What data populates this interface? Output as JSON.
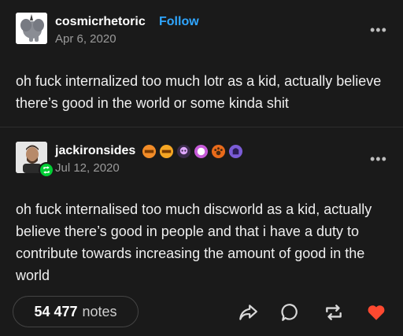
{
  "post1": {
    "username": "cosmicrhetoric",
    "follow_label": "Follow",
    "date": "Apr 6, 2020",
    "text": "oh fuck internalized too much lotr as a kid, actually believe there’s good in the world or some kinda shit",
    "more_label": "•••"
  },
  "post2": {
    "username": "jackironsides",
    "date": "Jul 12, 2020",
    "text": "oh fuck internalised too much discworld as a kid, actually believe there’s good in people and that i have a duty to contribute towards increasing the amount of good in the world",
    "more_label": "•••",
    "badge_icons": [
      "orange-badge-icon",
      "orange-badge-icon",
      "skull-badge-icon",
      "pink-badge-icon",
      "paw-badge-icon",
      "purple-badge-icon"
    ]
  },
  "footer": {
    "notes_count": "54 477",
    "notes_label": "notes",
    "like_color": "#ff4930"
  }
}
